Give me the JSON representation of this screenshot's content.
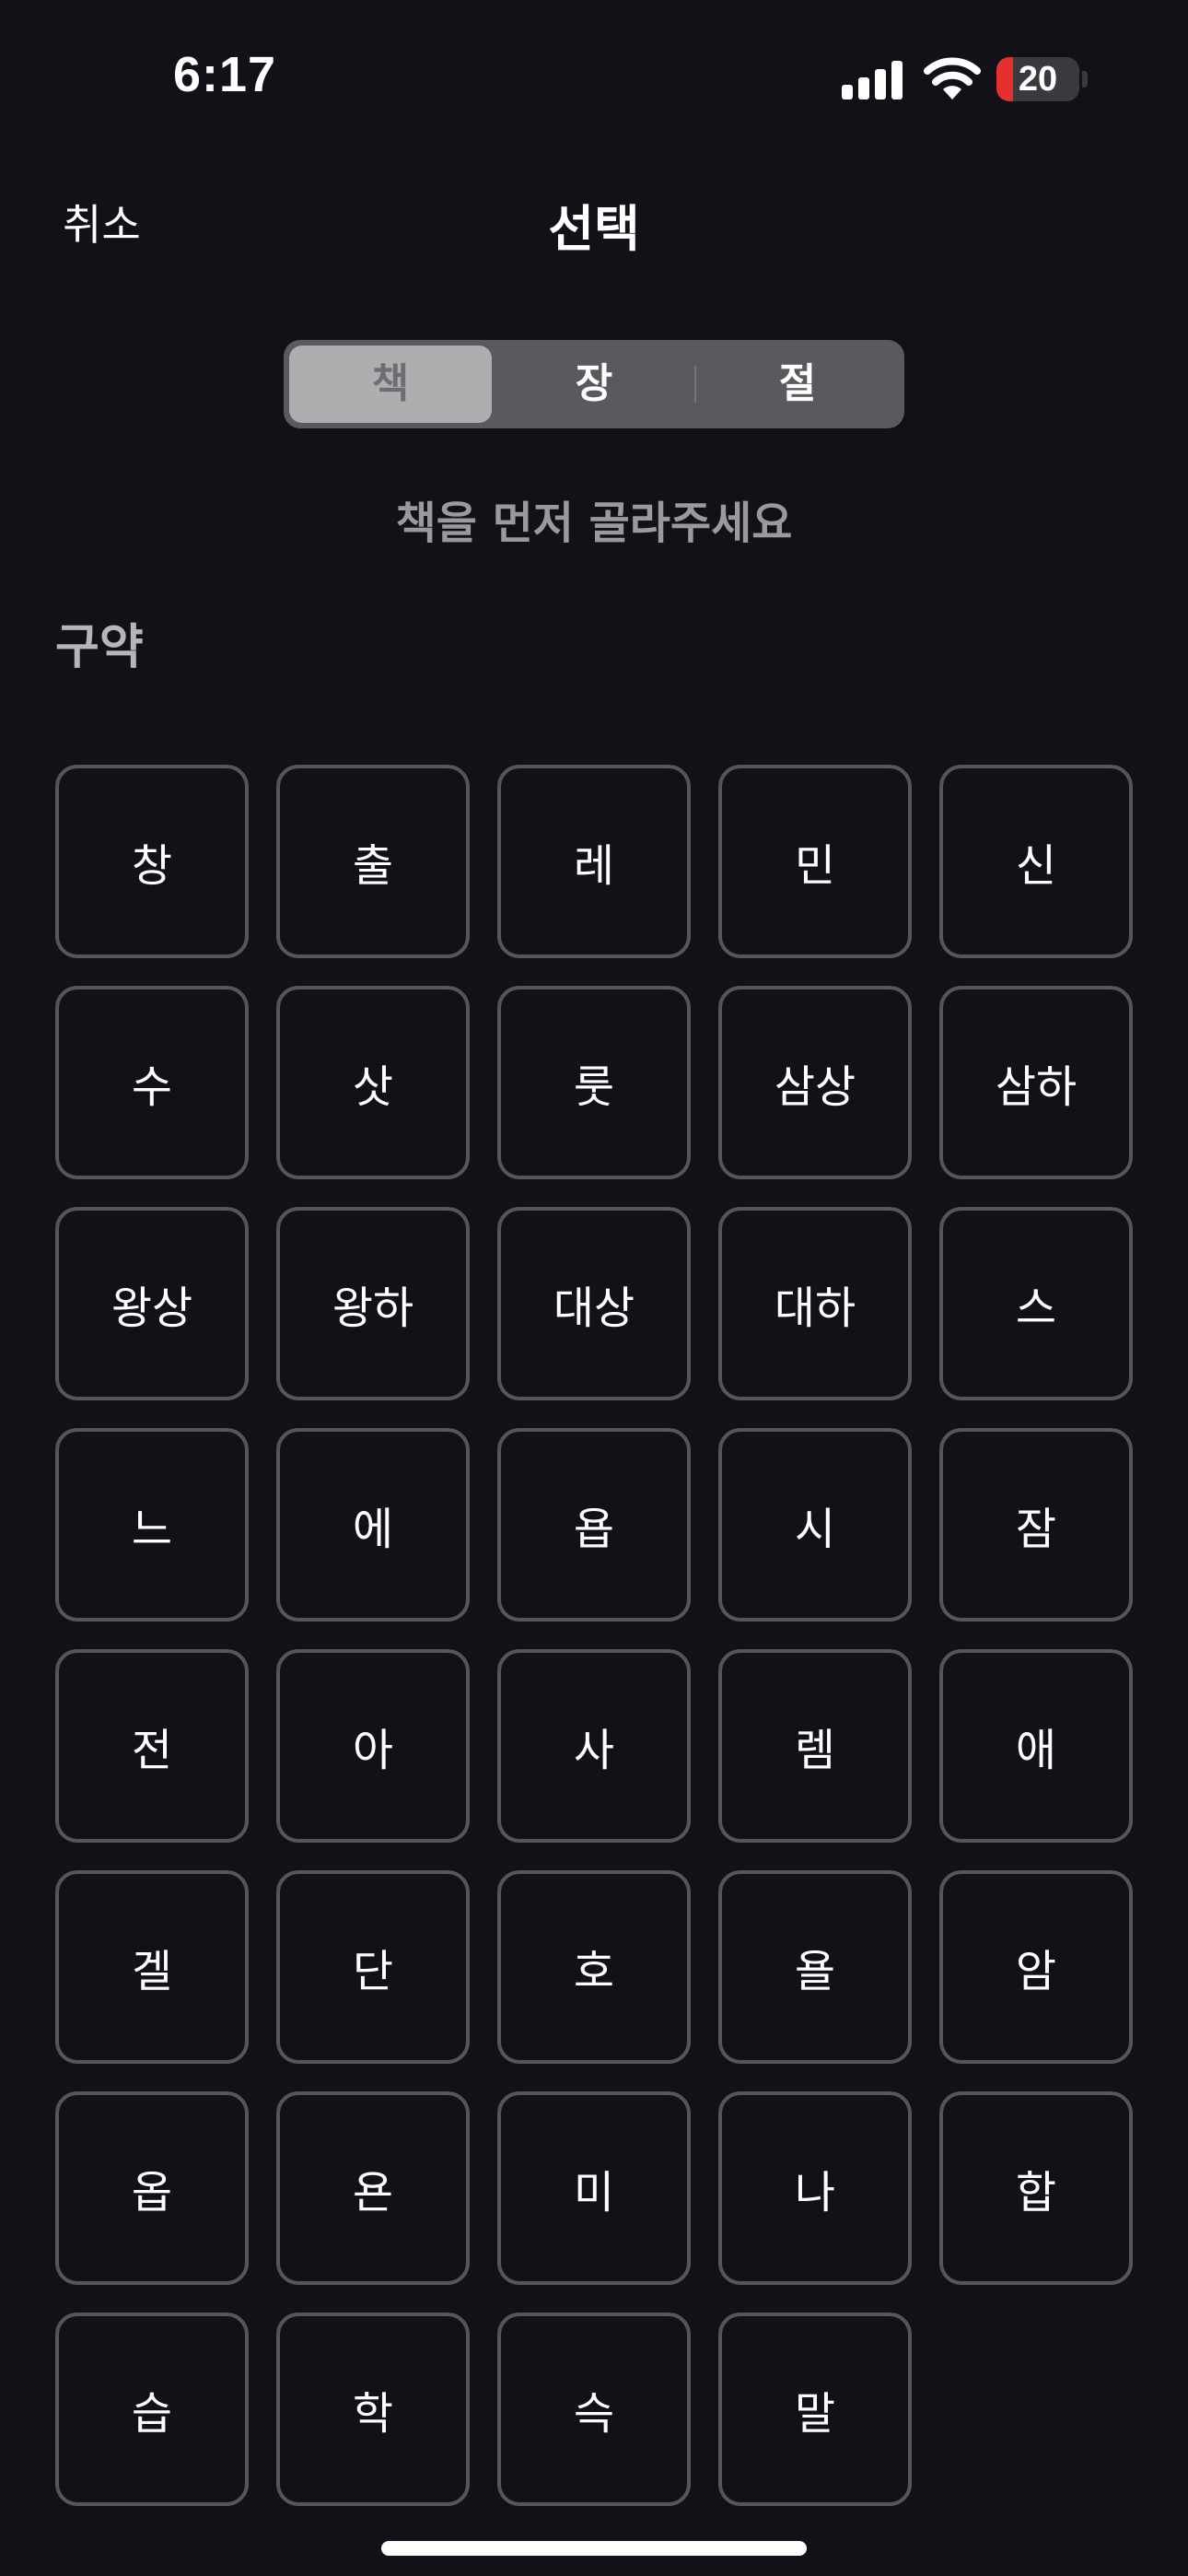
{
  "status_bar": {
    "time": "6:17",
    "signal_icon": "cellular-signal-icon",
    "wifi_icon": "wifi-icon",
    "battery_level": "20",
    "battery_fraction": 0.2,
    "battery_color": "#e5302e"
  },
  "nav": {
    "cancel_label": "취소",
    "title": "선택"
  },
  "segments": [
    {
      "label": "책",
      "selected": true
    },
    {
      "label": "장",
      "selected": false
    },
    {
      "label": "절",
      "selected": false
    }
  ],
  "instruction": "책을 먼저 골라주세요",
  "section_title": "구약",
  "books": [
    "창",
    "출",
    "레",
    "민",
    "신",
    "수",
    "삿",
    "룻",
    "삼상",
    "삼하",
    "왕상",
    "왕하",
    "대상",
    "대하",
    "스",
    "느",
    "에",
    "욥",
    "시",
    "잠",
    "전",
    "아",
    "사",
    "렘",
    "애",
    "겔",
    "단",
    "호",
    "욜",
    "암",
    "옵",
    "욘",
    "미",
    "나",
    "합",
    "습",
    "학",
    "슥",
    "말"
  ]
}
